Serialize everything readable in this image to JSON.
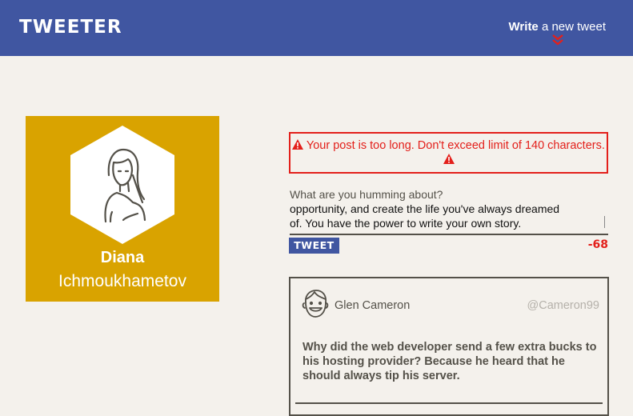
{
  "header": {
    "brand": "TWEETER",
    "compose_bold": "Write",
    "compose_rest": " a new tweet",
    "chevron_icon": "double-chevron-down-icon"
  },
  "profile": {
    "first_name": "Diana",
    "last_name": "Ichmoukhametov",
    "avatar_icon": "woman-avatar-icon"
  },
  "error": {
    "message": "Your post is too long. Don't exceed limit of 140 characters.",
    "icon": "warning-icon"
  },
  "composer": {
    "label": "What are you humming about?",
    "text_lines": [
      "opportunity, and create the life you've always dreamed",
      "of. You have the power to write your own story."
    ],
    "button_label": "TWEET",
    "counter": "-68"
  },
  "tweet": {
    "name": "Glen Cameron",
    "handle": "@Cameron99",
    "body": "Why did the web developer send a few extra bucks to his hosting provider? Because he heard that he should always tip his server.",
    "avatar_icon": "smiling-man-avatar-icon"
  },
  "colors": {
    "nav": "#4056a1",
    "background": "#f4f1ec",
    "profile_card": "#d9a300",
    "error": "#e3201b",
    "text": "#545149"
  }
}
